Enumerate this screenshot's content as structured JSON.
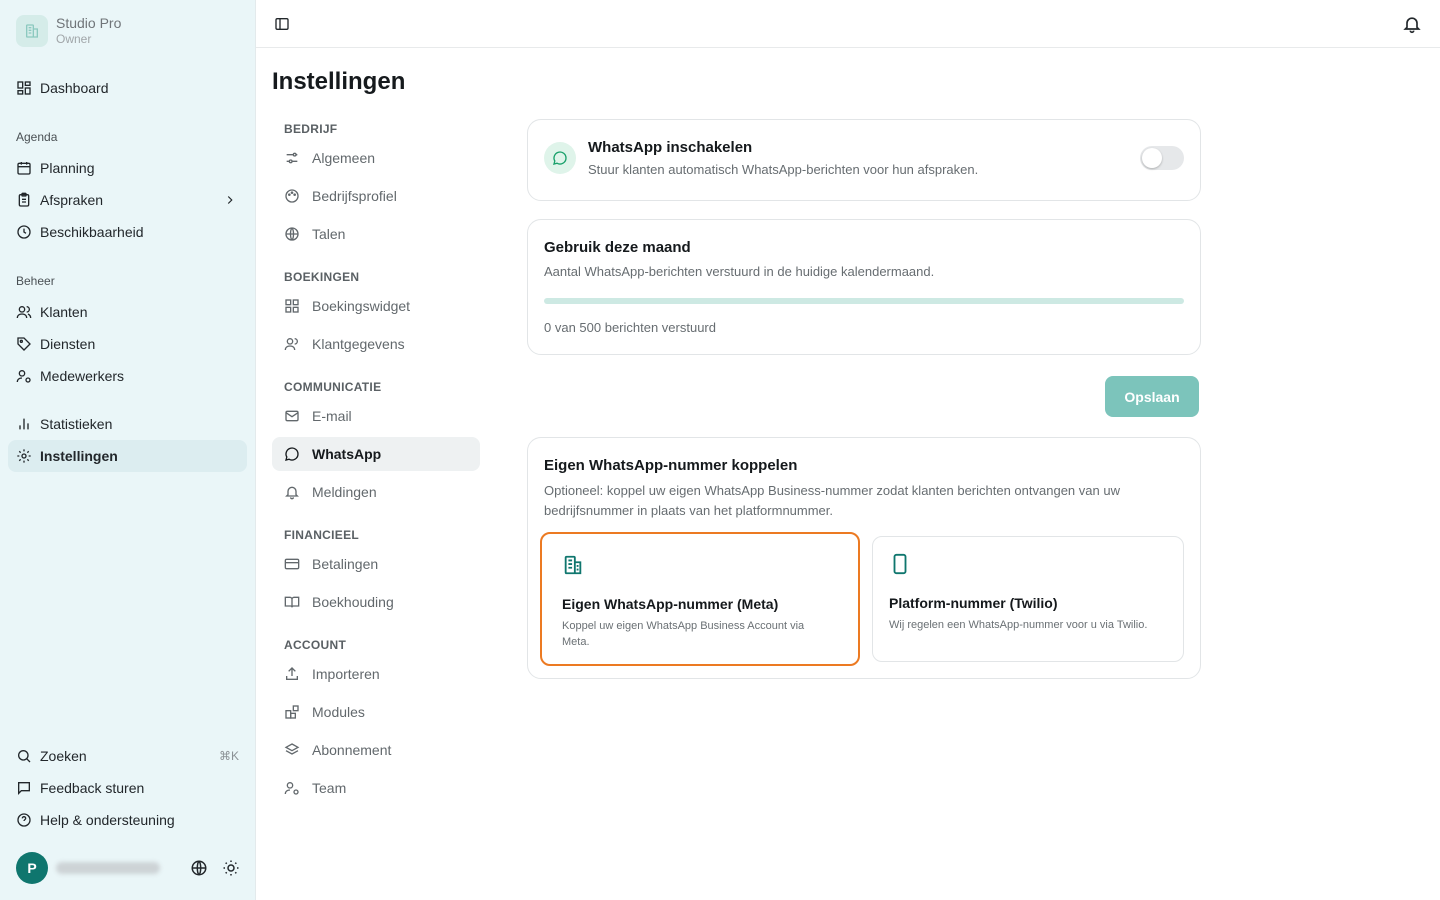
{
  "brand": {
    "name": "Studio Pro",
    "role": "Owner"
  },
  "sidebar": {
    "dashboard": "Dashboard",
    "group_agenda": "Agenda",
    "planning": "Planning",
    "afspraken": "Afspraken",
    "beschikbaarheid": "Beschikbaarheid",
    "group_beheer": "Beheer",
    "klanten": "Klanten",
    "diensten": "Diensten",
    "medewerkers": "Medewerkers",
    "statistieken": "Statistieken",
    "instellingen": "Instellingen",
    "zoeken": "Zoeken",
    "zoeken_shortcut": "⌘K",
    "feedback": "Feedback sturen",
    "help": "Help & ondersteuning",
    "avatar_initial": "P"
  },
  "page": {
    "title": "Instellingen"
  },
  "settings_nav": {
    "bedrijf": "BEDRIJF",
    "algemeen": "Algemeen",
    "bedrijfsprofiel": "Bedrijfsprofiel",
    "talen": "Talen",
    "boekingen": "BOEKINGEN",
    "boekingswidget": "Boekingswidget",
    "klantgegevens": "Klantgegevens",
    "communicatie": "COMMUNICATIE",
    "email": "E-mail",
    "whatsapp": "WhatsApp",
    "meldingen": "Meldingen",
    "financieel": "FINANCIEEL",
    "betalingen": "Betalingen",
    "boekhouding": "Boekhouding",
    "account": "ACCOUNT",
    "importeren": "Importeren",
    "modules": "Modules",
    "abonnement": "Abonnement",
    "team": "Team"
  },
  "whatsapp_card": {
    "title": "WhatsApp inschakelen",
    "description": "Stuur klanten automatisch WhatsApp-berichten voor hun afspraken.",
    "enabled": false
  },
  "usage_card": {
    "title": "Gebruik deze maand",
    "description": "Aantal WhatsApp-berichten verstuurd in de huidige kalendermaand.",
    "used": 0,
    "limit": 500,
    "progress_fraction": 0,
    "summary": "0 van 500 berichten verstuurd"
  },
  "save_button": "Opslaan",
  "connect_card": {
    "title": "Eigen WhatsApp-nummer koppelen",
    "description": "Optioneel: koppel uw eigen WhatsApp Business-nummer zodat klanten berichten ontvangen van uw bedrijfsnummer in plaats van het platformnummer.",
    "options": [
      {
        "title": "Eigen WhatsApp-nummer (Meta)",
        "description": "Koppel uw eigen WhatsApp Business Account via Meta.",
        "icon": "building-icon",
        "selected": true
      },
      {
        "title": "Platform-nummer (Twilio)",
        "description": "Wij regelen een WhatsApp-nummer voor u via Twilio.",
        "icon": "phone-icon",
        "selected": false
      }
    ]
  },
  "colors": {
    "accent": "#0f766e",
    "selected_border": "#ec7a22",
    "sidebar_bg": "#eaf6f8"
  }
}
